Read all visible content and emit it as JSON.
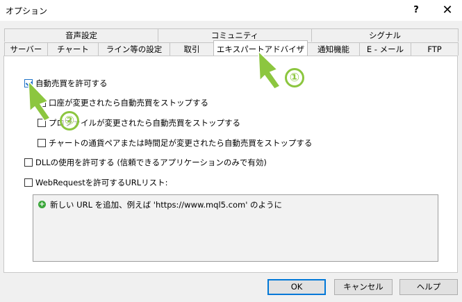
{
  "window": {
    "title": "オプション",
    "help": "?",
    "close": "✕"
  },
  "tabs_top": [
    {
      "label": "音声設定"
    },
    {
      "label": "コミュニティ"
    },
    {
      "label": "シグナル"
    }
  ],
  "tabs_bottom": [
    {
      "label": "サーバー"
    },
    {
      "label": "チャート"
    },
    {
      "label": "ライン等の設定"
    },
    {
      "label": "取引"
    },
    {
      "label": "エキスパートアドバイザ",
      "active": true
    },
    {
      "label": "通知機能"
    },
    {
      "label": "E - メール"
    },
    {
      "label": "FTP"
    }
  ],
  "options": {
    "auto_trading": {
      "label": "自動売買を許可する",
      "checked": true
    },
    "stop_on_account_change": {
      "label": "口座が変更されたら自動売買をストップする",
      "checked": false
    },
    "stop_on_profile_change": {
      "label": "プロファイルが変更されたら自動売買をストップする",
      "checked": false
    },
    "stop_on_symbol_change": {
      "label": "チャートの通貨ペアまたは時間足が変更されたら自動売買をストップする",
      "checked": false
    },
    "allow_dll": {
      "label": "DLLの使用を許可する (信頼できるアプリケーションのみで有効)",
      "checked": false
    },
    "allow_webrequest": {
      "label": "WebRequestを許可するURLリスト:",
      "checked": false
    }
  },
  "url_list": {
    "add_hint": "新しい URL を追加、例えば 'https://www.mql5.com' のように",
    "add_icon": "plus-circle-icon"
  },
  "buttons": {
    "ok": "OK",
    "cancel": "キャンセル",
    "help": "ヘルプ"
  },
  "annotations": {
    "one": "①",
    "two": "②",
    "color": "#8cc63f"
  }
}
